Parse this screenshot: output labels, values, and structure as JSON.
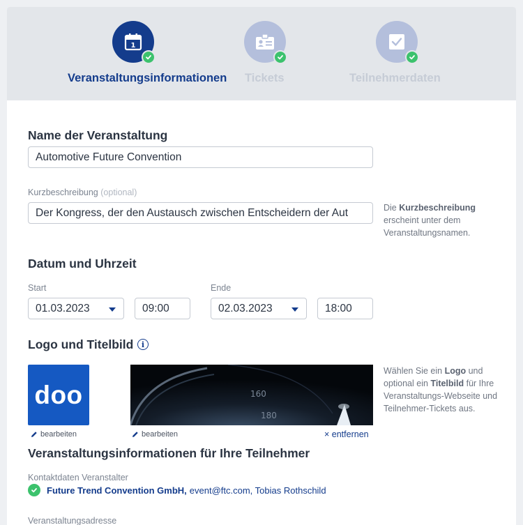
{
  "steps": [
    {
      "label": "Veranstaltungsinformationen",
      "state": "active",
      "icon": "calendar-icon",
      "done": true
    },
    {
      "label": "Tickets",
      "state": "inactive",
      "icon": "id-card-icon",
      "done": true
    },
    {
      "label": "Teilnehmerdaten",
      "state": "inactive",
      "icon": "checkbox-icon",
      "done": true
    }
  ],
  "event_name": {
    "heading": "Name der Veranstaltung",
    "value": "Automotive Future Convention"
  },
  "short_description": {
    "label": "Kurzbeschreibung",
    "optional": "(optional)",
    "value": "Der Kongress, der den Austausch zwischen Entscheidern der Aut",
    "hint_pre": "Die",
    "hint_bold": "Kurzbeschreibung",
    "hint_post": "erscheint unter dem Veranstaltungsnamen."
  },
  "datetime": {
    "heading": "Datum und Uhrzeit",
    "start_label": "Start",
    "start_date": "01.03.2023",
    "start_time": "09:00",
    "end_label": "Ende",
    "end_date": "02.03.2023",
    "end_time": "18:00"
  },
  "logo": {
    "heading": "Logo und Titelbild",
    "info_icon": "i",
    "logo_text": "doo",
    "edit_label": "bearbeiten",
    "remove_label": "× entfernen",
    "hint_1": "Wählen Sie ein",
    "hint_bold_1": "Logo",
    "hint_2": "und optional ein",
    "hint_bold_2": "Titelbild",
    "hint_3": "für Ihre Veranstaltungs-Webseite und Teilnehmer-Tickets aus.",
    "gauge_numbers": [
      "160",
      "180"
    ]
  },
  "participant_info": {
    "heading": "Veranstaltungsinformationen für Ihre Teilnehmer",
    "contact_label": "Kontaktdaten Veranstalter",
    "contact_org": "Future Trend Convention GmbH,",
    "contact_rest": "event@ftc.com, Tobias Rothschild",
    "address_label": "Veranstaltungsadresse"
  },
  "colors": {
    "primary": "#143c8c",
    "step_inactive": "#b4bfdc",
    "success": "#3cc26d",
    "logo_bg": "#1559c2"
  }
}
